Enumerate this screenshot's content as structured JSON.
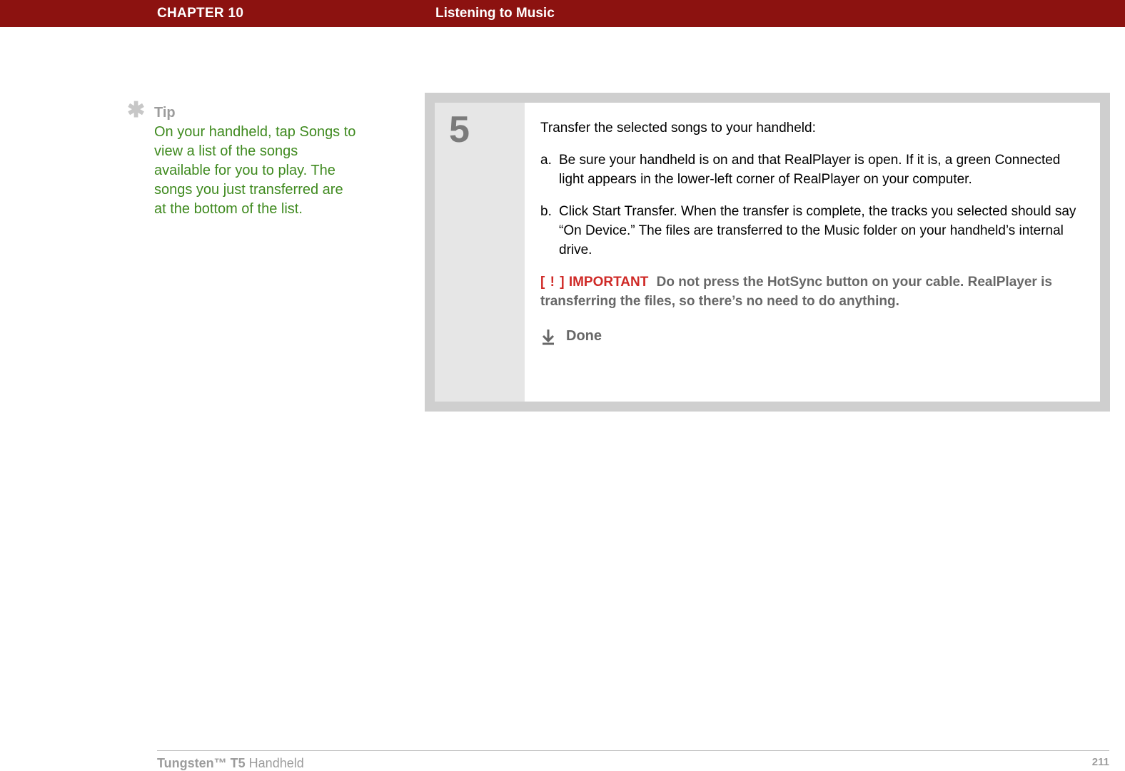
{
  "banner": {
    "chapter": "CHAPTER 10",
    "title": "Listening to Music"
  },
  "tip": {
    "icon": "✱",
    "heading": "Tip",
    "body": "On your handheld, tap Songs to view a list of the songs available for you to play. The songs you just transferred are at the bottom of the list."
  },
  "step": {
    "number": "5",
    "intro": "Transfer the selected songs to your handheld:",
    "substeps": [
      {
        "letter": "a.",
        "text": "Be sure your handheld is on and that RealPlayer is open. If it is, a green Connected light appears in the lower-left corner of RealPlayer on your computer."
      },
      {
        "letter": "b.",
        "text": "Click Start Transfer. When the transfer is complete, the tracks you selected should say “On Device.” The files are transferred to the Music folder on your handheld’s internal drive."
      }
    ],
    "important": {
      "brackets": "[ ! ]",
      "label": "IMPORTANT",
      "text": "Do not press the HotSync button on your cable. RealPlayer is transferring the files, so there’s no need to do anything."
    },
    "done": "Done"
  },
  "footer": {
    "product_bold": "Tungsten™ T5",
    "product_rest": " Handheld",
    "page": "211"
  }
}
